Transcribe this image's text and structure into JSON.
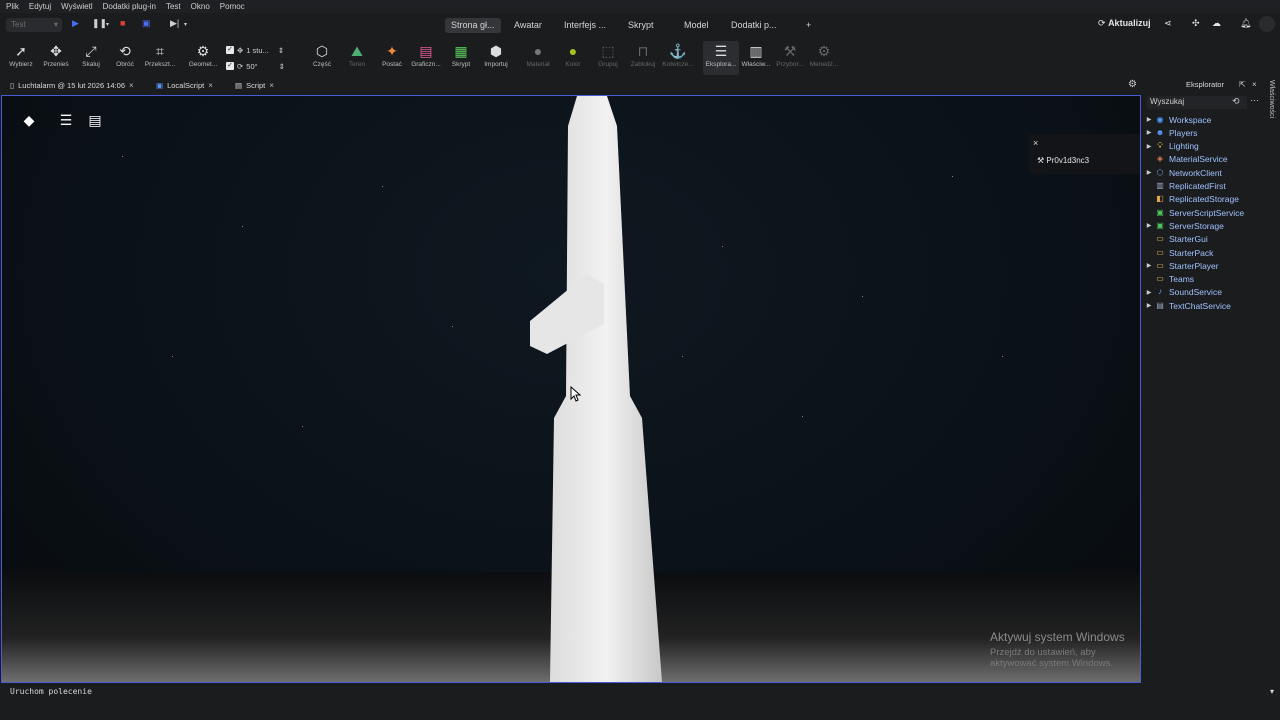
{
  "menu": [
    "Plik",
    "Edytuj",
    "Wyświetl",
    "Dodatki plug-in",
    "Test",
    "Okno",
    "Pomoc"
  ],
  "run_selector": {
    "value": "Test"
  },
  "nav_tabs": [
    "Strona gł...",
    "Awatar",
    "Interfejs ...",
    "Skrypt",
    "Model",
    "Dodatki p...",
    "+"
  ],
  "top_right": {
    "update_label": "Aktualizuj"
  },
  "ribbon": {
    "tools": [
      "Wybierz",
      "Przenieś",
      "Skaluj",
      "Obróć",
      "Przekszt...",
      "Geomet..."
    ],
    "snap_move": "1 stu...",
    "snap_rotate": "50°",
    "insert": [
      "Część",
      "Teren",
      "Postać",
      "Graficzn...",
      "Skrypt",
      "Importuj"
    ],
    "edit": [
      "Materiał",
      "Kolor",
      "Grupuj",
      "Zablokuj",
      "Kotwicze..."
    ],
    "windows": [
      "Eksplora...",
      "Właściw...",
      "Przybor...",
      "Menedż..."
    ]
  },
  "doc_tabs": [
    "Luchtalarm @ 15 lut 2026 14:06",
    "LocalScript",
    "Script"
  ],
  "viewport": {
    "notice_user": "Pr0v1d3nc3",
    "watermark_title": "Aktywuj system Windows",
    "watermark_sub": "Przejdź do ustawień, aby aktywować system Windows."
  },
  "explorer": {
    "title": "Eksplorator",
    "search_placeholder": "Wyszukaj",
    "items": [
      {
        "label": "Workspace",
        "icon": "globe-icon",
        "expandable": true,
        "color": "#4aa3ff"
      },
      {
        "label": "Players",
        "icon": "players-icon",
        "expandable": true,
        "color": "#5aa0ff"
      },
      {
        "label": "Lighting",
        "icon": "bulb-icon",
        "expandable": true,
        "color": "#f2d23a"
      },
      {
        "label": "MaterialService",
        "icon": "material-icon",
        "expandable": false,
        "color": "#e07a5a"
      },
      {
        "label": "NetworkClient",
        "icon": "network-icon",
        "expandable": true,
        "color": "#6aa0d8"
      },
      {
        "label": "ReplicatedFirst",
        "icon": "replicated-icon",
        "expandable": false,
        "color": "#9aa7c7"
      },
      {
        "label": "ReplicatedStorage",
        "icon": "storage-icon",
        "expandable": false,
        "color": "#e0a84a"
      },
      {
        "label": "ServerScriptService",
        "icon": "script-service-icon",
        "expandable": false,
        "color": "#4cc35a"
      },
      {
        "label": "ServerStorage",
        "icon": "server-storage-icon",
        "expandable": true,
        "color": "#4cc35a"
      },
      {
        "label": "StarterGui",
        "icon": "folder-icon",
        "expandable": false,
        "color": "#e8c063"
      },
      {
        "label": "StarterPack",
        "icon": "folder-icon",
        "expandable": false,
        "color": "#e8c063"
      },
      {
        "label": "StarterPlayer",
        "icon": "folder-icon",
        "expandable": true,
        "color": "#e8c063"
      },
      {
        "label": "Teams",
        "icon": "teams-icon",
        "expandable": false,
        "color": "#e8c063"
      },
      {
        "label": "SoundService",
        "icon": "sound-icon",
        "expandable": true,
        "color": "#5ab0e8"
      },
      {
        "label": "TextChatService",
        "icon": "chat-icon",
        "expandable": true,
        "color": "#9aa7c7"
      }
    ]
  },
  "side_strip_label": "Właściwości",
  "command_bar": {
    "placeholder": "Uruchom polecenie"
  },
  "colors": {
    "accent": "#4a5bd6",
    "explorer_text": "#9fc2ff",
    "background": "#1b1c1e"
  }
}
